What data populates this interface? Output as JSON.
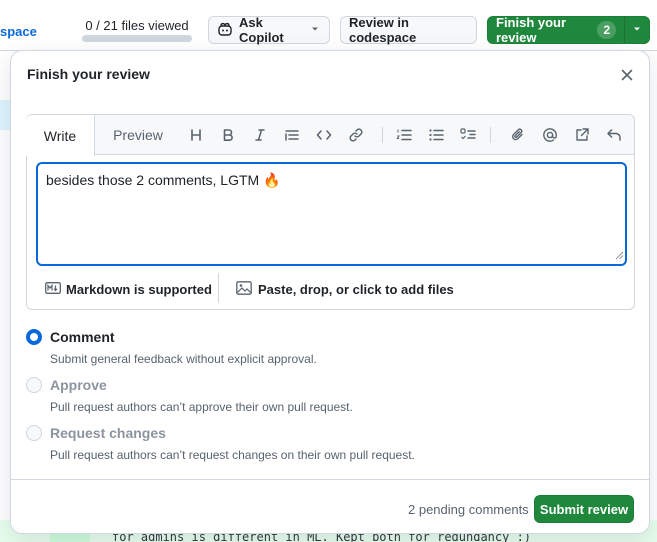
{
  "background": {
    "left_link": "space",
    "files_viewed": "0 / 21 files viewed",
    "files_viewed_fraction": 0,
    "ask_copilot": "Ask Copilot",
    "review_codespace": "Review in codespace",
    "finish_review": "Finish your review",
    "finish_count": "2",
    "code_line": "for admins is different in ML. Kept both for redundancy :)"
  },
  "popover": {
    "title": "Finish your review",
    "tabs": {
      "write": "Write",
      "preview": "Preview"
    },
    "toolbar_icons": [
      "heading-icon",
      "bold-icon",
      "italic-icon",
      "quote-icon",
      "code-icon",
      "link-icon",
      "ordered-list-icon",
      "unordered-list-icon",
      "task-list-icon",
      "attach-icon",
      "mention-icon",
      "reference-icon",
      "undo-icon"
    ],
    "textarea_value": "besides those 2 comments, LGTM 🔥",
    "markdown_note": "Markdown is supported",
    "attach_note": "Paste, drop, or click to add files",
    "options": [
      {
        "label": "Comment",
        "desc": "Submit general feedback without explicit approval.",
        "checked": true,
        "disabled": false
      },
      {
        "label": "Approve",
        "desc": "Pull request authors can’t approve their own pull request.",
        "checked": false,
        "disabled": true
      },
      {
        "label": "Request changes",
        "desc": "Pull request authors can’t request changes on their own pull request.",
        "checked": false,
        "disabled": true
      }
    ],
    "pending_comments": "2 pending comments",
    "submit": "Submit review"
  },
  "colors": {
    "accent_blue": "#0969da",
    "primary_green": "#1f883d",
    "border": "#d0d7de",
    "muted_text": "#59636e"
  }
}
